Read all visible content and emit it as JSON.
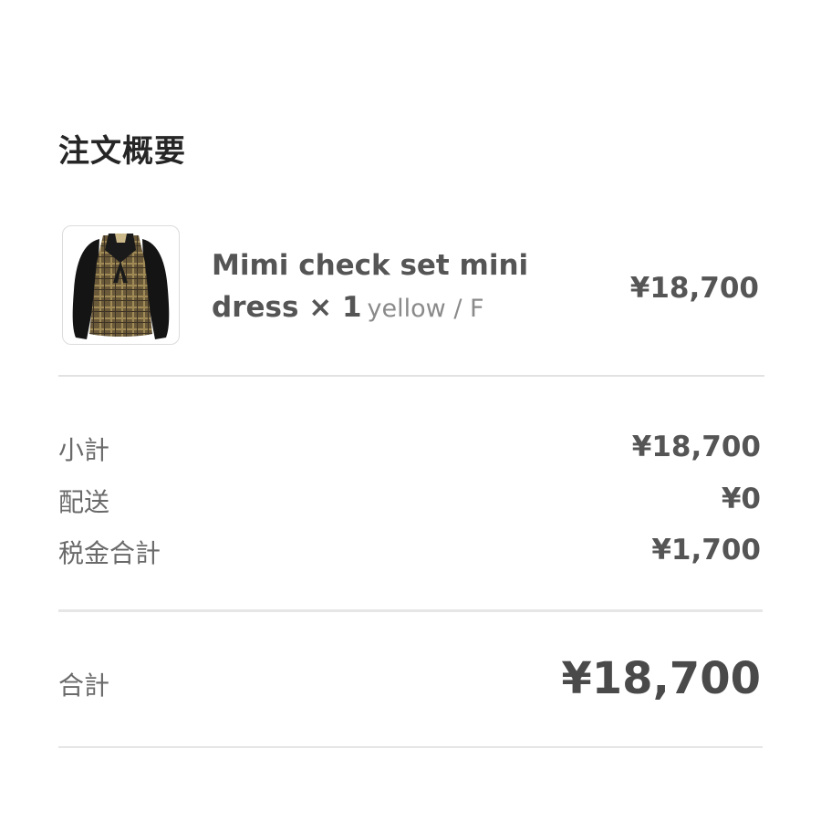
{
  "summary": {
    "title": "注文概要"
  },
  "item": {
    "name": "Mimi check set mini dress × 1",
    "variant": "yellow / F",
    "price": "¥18,700",
    "thumbnail_icon": "dress-thumbnail"
  },
  "breakdown": [
    {
      "label": "小計",
      "value": "¥18,700"
    },
    {
      "label": "配送",
      "value": "¥0"
    },
    {
      "label": "税金合計",
      "value": "¥1,700"
    }
  ],
  "total": {
    "label": "合計",
    "value": "¥18,700"
  }
}
